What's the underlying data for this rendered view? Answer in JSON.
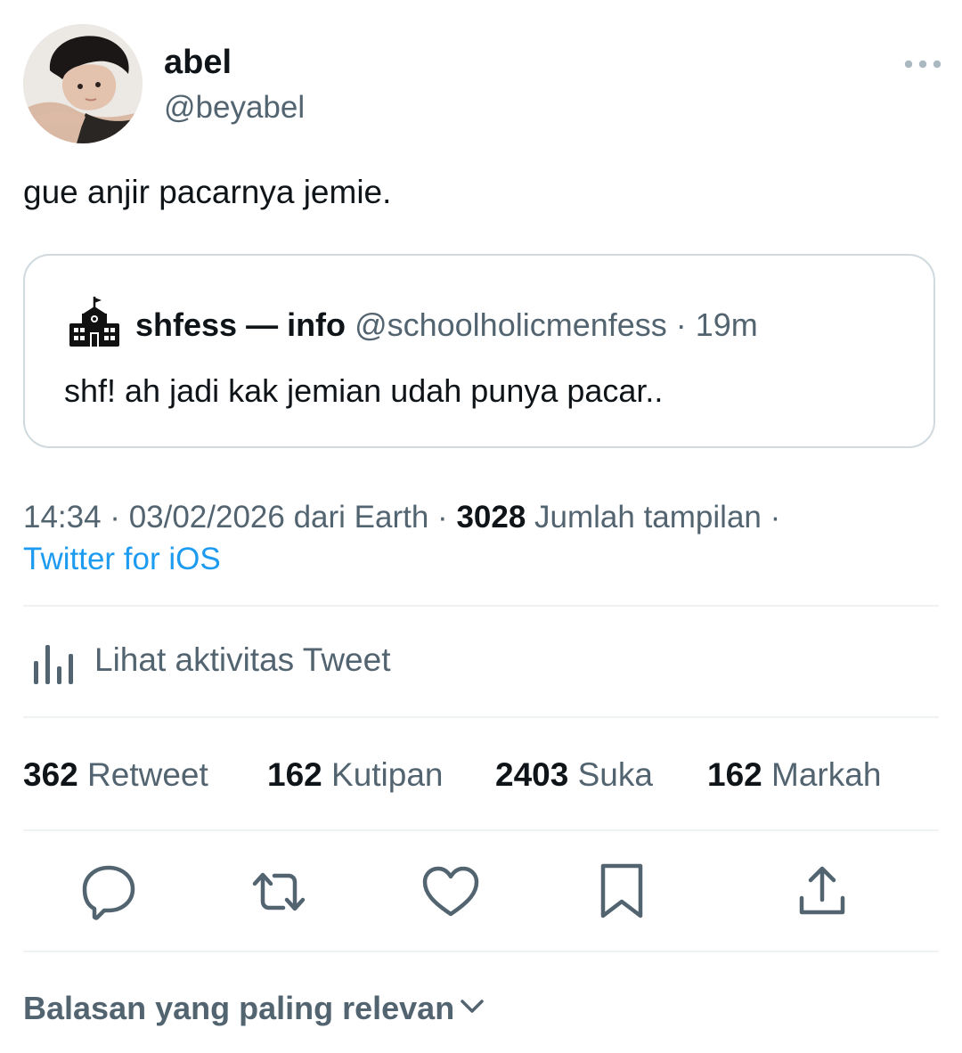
{
  "author": {
    "display_name": "abel",
    "handle": "@beyabel",
    "avatar_icon": "profile-photo"
  },
  "tweet": {
    "text": "gue anjir pacarnya jemie."
  },
  "quoted_tweet": {
    "avatar_icon": "school-building-icon",
    "display_name": "shfess — info",
    "meta": "@schoolholicmenfess · 19m",
    "text": "shf! ah jadi kak jemian udah punya pacar.."
  },
  "meta": {
    "time_date": "14:34 · 03/02/2026 dari Earth · ",
    "views_count": "3028",
    "views_label": " Jumlah tampilan ·",
    "source": "Twitter for iOS"
  },
  "activity": {
    "icon": "bar-chart-icon",
    "label": "Lihat aktivitas Tweet"
  },
  "stats": [
    {
      "count": "362",
      "label": "Retweet"
    },
    {
      "count": "162",
      "label": "Kutipan"
    },
    {
      "count": "2403",
      "label": "Suka"
    },
    {
      "count": "162",
      "label": "Markah"
    }
  ],
  "actions": [
    "reply-icon",
    "retweet-icon",
    "like-icon",
    "bookmark-icon",
    "share-icon"
  ],
  "replies": {
    "sort_label": "Balasan yang paling relevan"
  },
  "colors": {
    "primary_text": "#0f1419",
    "secondary_text": "#536471",
    "link": "#1d9bf0",
    "border": "#cfd9de",
    "divider": "#eff3f4"
  }
}
